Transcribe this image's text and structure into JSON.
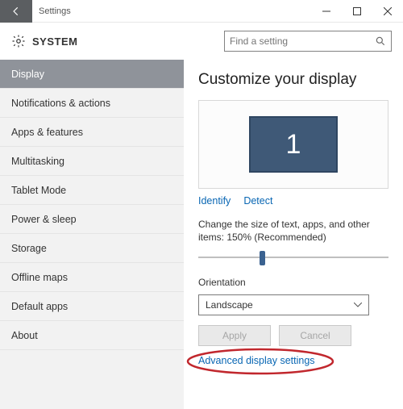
{
  "titlebar": {
    "title": "Settings"
  },
  "header": {
    "title": "SYSTEM",
    "search_placeholder": "Find a setting"
  },
  "sidebar": {
    "items": [
      {
        "label": "Display",
        "active": true
      },
      {
        "label": "Notifications & actions"
      },
      {
        "label": "Apps & features"
      },
      {
        "label": "Multitasking"
      },
      {
        "label": "Tablet Mode"
      },
      {
        "label": "Power & sleep"
      },
      {
        "label": "Storage"
      },
      {
        "label": "Offline maps"
      },
      {
        "label": "Default apps"
      },
      {
        "label": "About"
      }
    ]
  },
  "content": {
    "heading": "Customize your display",
    "monitor_number": "1",
    "identify": "Identify",
    "detect": "Detect",
    "scale_label": "Change the size of text, apps, and other items: 150% (Recommended)",
    "slider_percent": 32,
    "orientation_label": "Orientation",
    "orientation_value": "Landscape",
    "apply": "Apply",
    "cancel": "Cancel",
    "advanced": "Advanced display settings"
  },
  "colors": {
    "accent": "#3f5977",
    "link": "#0866b3",
    "highlight_ring": "#c1272d"
  }
}
